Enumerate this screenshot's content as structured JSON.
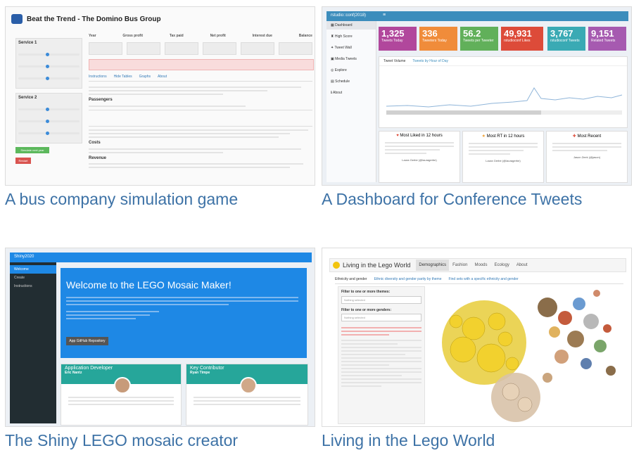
{
  "gallery": [
    {
      "caption": "A bus company simulation game",
      "app": {
        "title": "Beat the Trend - The Domino Bus Group",
        "service1": "Service 1",
        "service2": "Service 2",
        "columns": [
          "Year",
          "Gross profit",
          "Tax paid",
          "Net profit",
          "Interest due",
          "Balance"
        ],
        "tabs": [
          "Instructions",
          "Hide Tables",
          "Graphs",
          "About"
        ],
        "sections": [
          "Passengers",
          "Costs",
          "Revenue"
        ],
        "btn_go": "Simulate next year",
        "btn_reset": "Restart"
      }
    },
    {
      "caption": "A Dashboard for Conference Tweets",
      "app": {
        "brand": "rstudio::conf(2018)",
        "nav": [
          "Dashboard",
          "High Score",
          "Tweet Wall",
          "Media Tweets",
          "Explore",
          "Schedule",
          "About"
        ],
        "stats": [
          {
            "value": "1,325",
            "label": "Tweets Today",
            "color": "#b1479c"
          },
          {
            "value": "336",
            "label": "Tweeters Today",
            "color": "#f08c3a"
          },
          {
            "value": "56.2",
            "label": "Tweets per Tweeter",
            "color": "#61b05a"
          },
          {
            "value": "49,931",
            "label": "rstudioconf Likes",
            "color": "#dd4b39"
          },
          {
            "value": "3,767",
            "label": "rstudioconf Tweets",
            "color": "#3aaab4"
          },
          {
            "value": "9,151",
            "label": "Related Tweets",
            "color": "#a65ab0"
          }
        ],
        "chart_tabs": [
          "Tweet Volume",
          "Tweets by Hour of Day"
        ],
        "columns": [
          {
            "title": "Most Liked in 12 hours",
            "icon": "heart-icon",
            "author": "Laura Gerbe (@lauragerbe)"
          },
          {
            "title": "Most RT in 12 hours",
            "icon": "star-icon",
            "author": "Laura Gerbe (@lauragerbe)"
          },
          {
            "title": "Most Recent",
            "icon": "gift-icon",
            "author": "Jason Zeek (@jason)"
          }
        ]
      }
    },
    {
      "caption": "The Shiny LEGO mosaic creator",
      "app": {
        "brand": "Shiny2020",
        "nav": [
          "Welcome",
          "Create",
          "Instructions"
        ],
        "hero_title": "Welcome to the LEGO Mosaic Maker!",
        "hero_btn": "App GitHub Repository",
        "dev_title": "Application Developer",
        "dev_name": "Eric Nantz",
        "contrib_title": "Key Contributor",
        "contrib_name": "Ryan Timpe"
      }
    },
    {
      "caption": "Living in the Lego World",
      "app": {
        "title": "Living in the Lego World",
        "nav": [
          "Demographics",
          "Fashion",
          "Moods",
          "Ecology",
          "About"
        ],
        "tabs": [
          "Ethnicity and gender",
          "Ethnic diversity and gender parity by theme",
          "Find sets with a specific ethnicity and gender"
        ],
        "filter1": "Filter to one or more themes:",
        "filter2": "Filter to one or more genders:",
        "placeholder": "Nothing selected"
      }
    }
  ]
}
